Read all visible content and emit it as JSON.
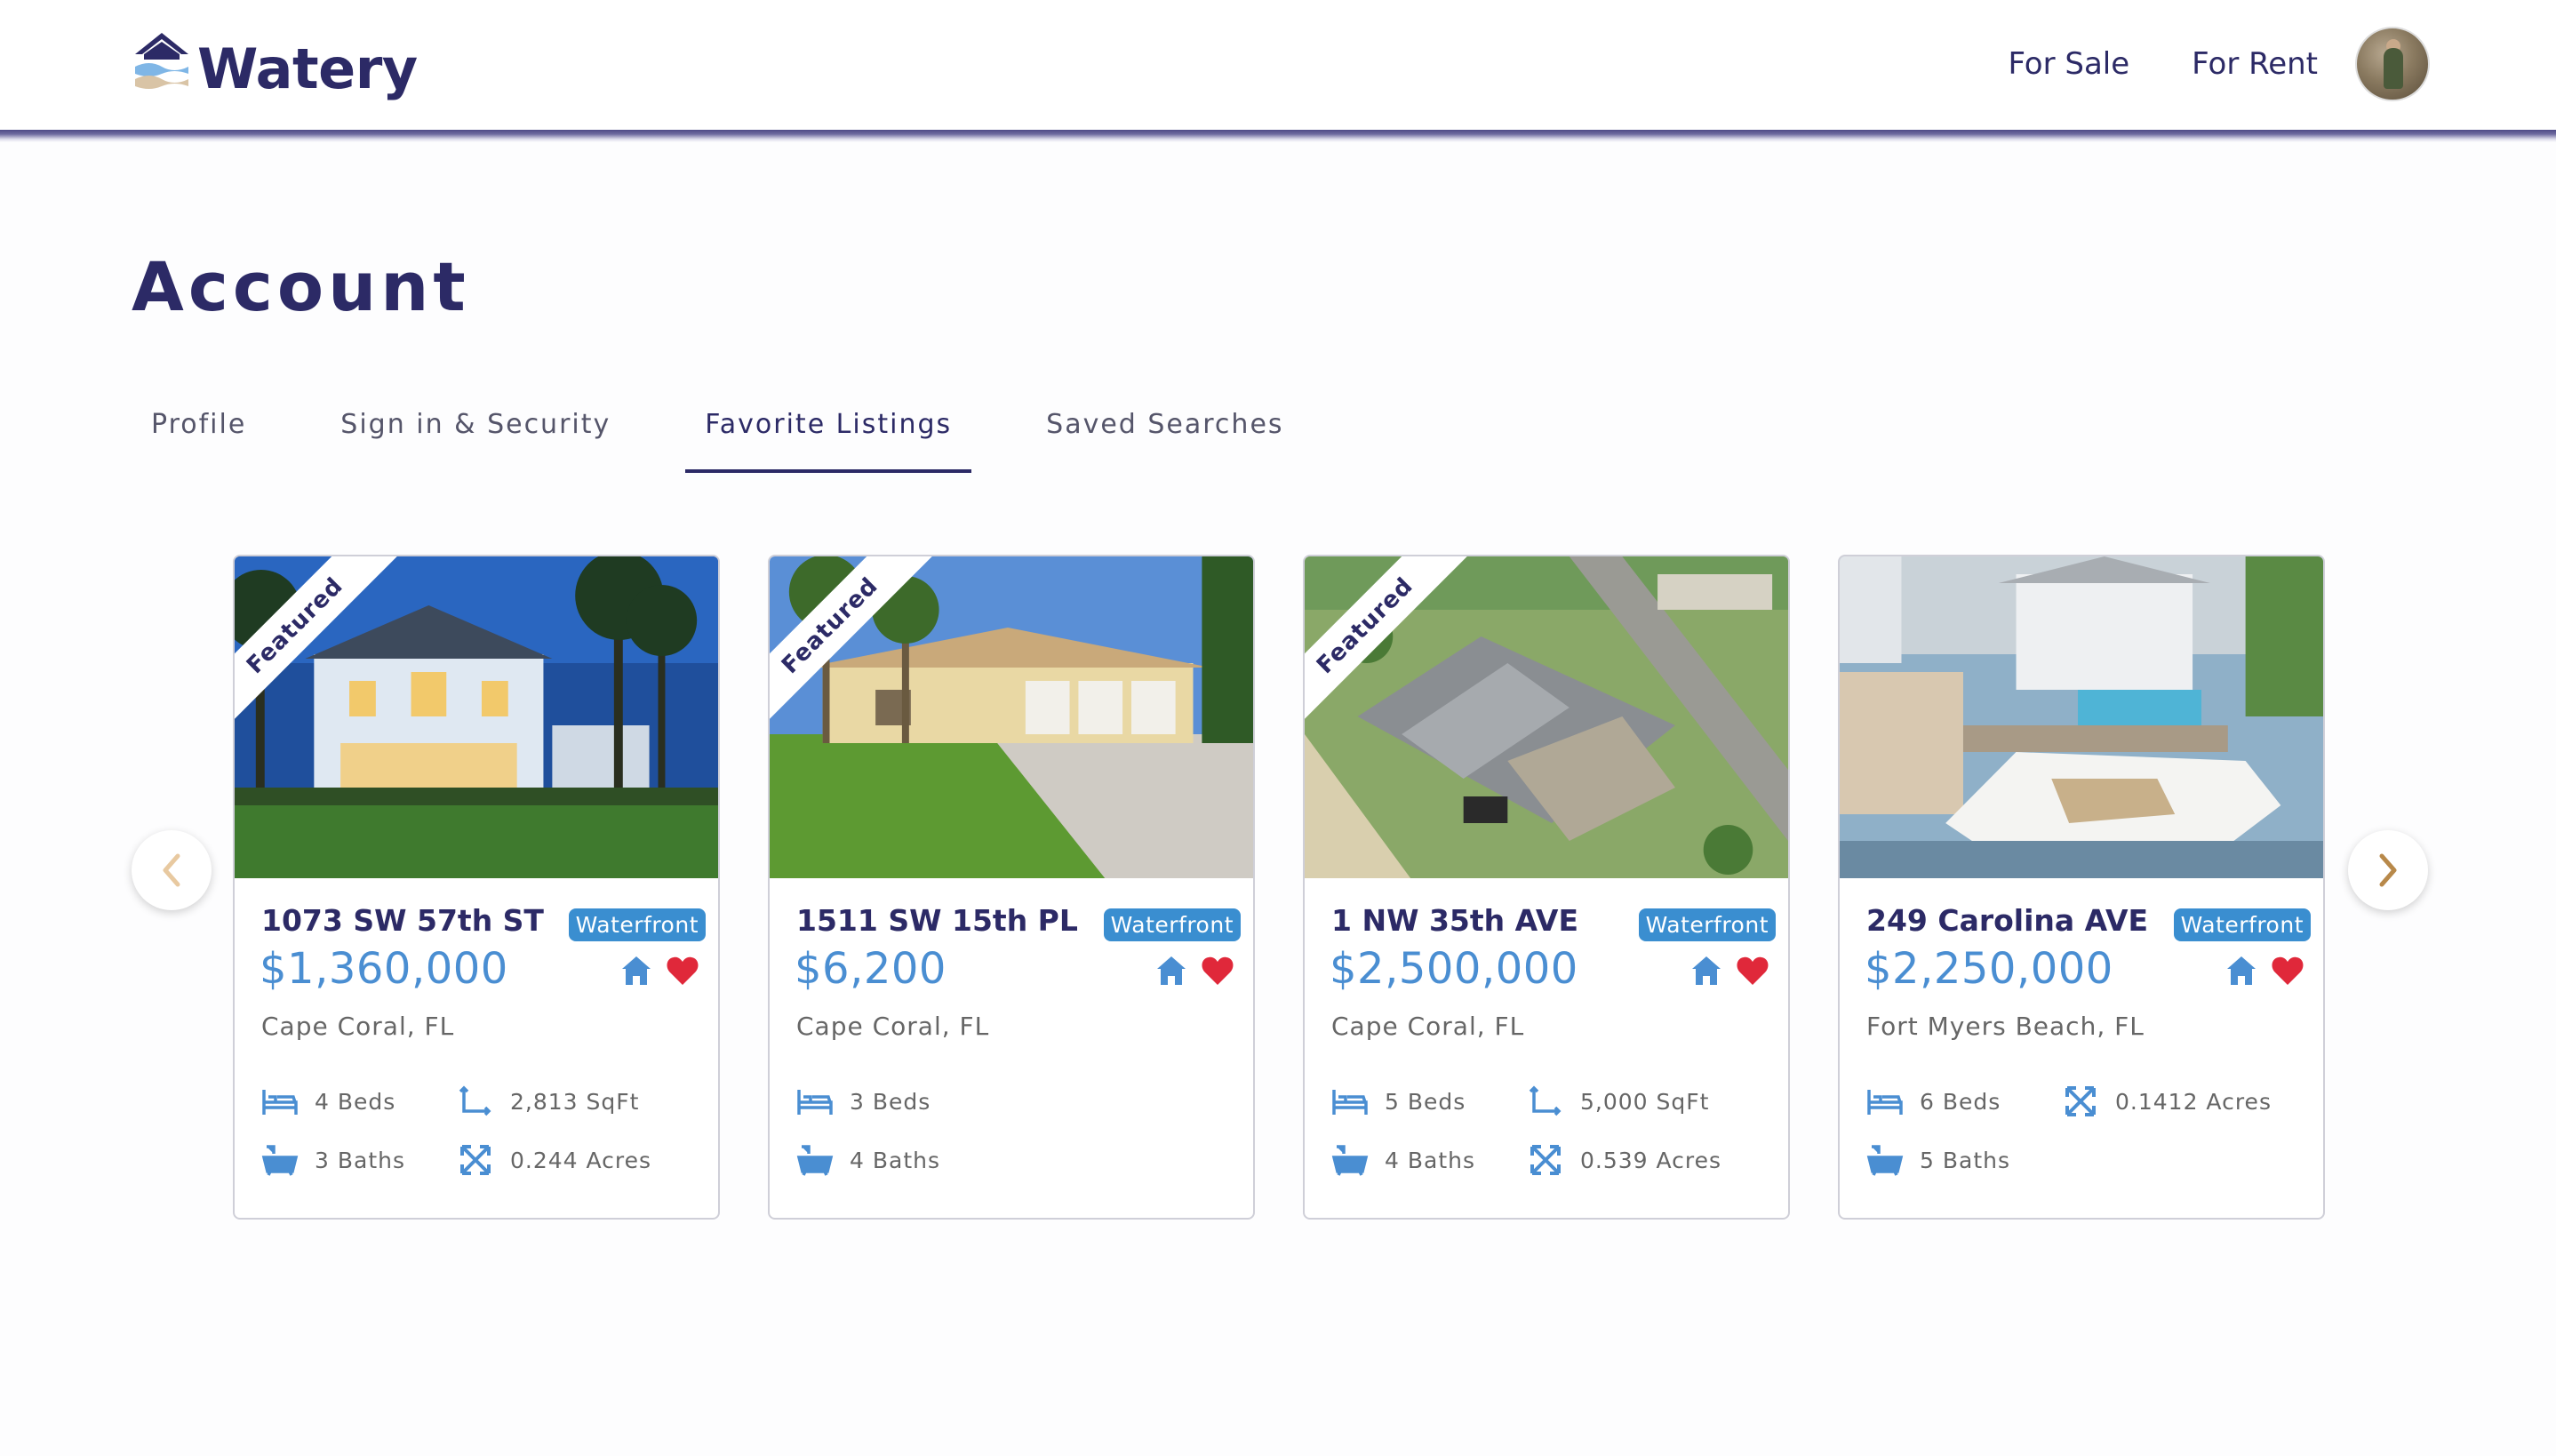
{
  "brand": {
    "name": "Watery",
    "logo_icon": "house-waves-logo"
  },
  "nav": {
    "for_sale": "For Sale",
    "for_rent": "For Rent",
    "avatar_icon": "user-avatar"
  },
  "page": {
    "title": "Account"
  },
  "tabs": [
    {
      "label": "Profile",
      "active": false
    },
    {
      "label": "Sign in & Security",
      "active": false
    },
    {
      "label": "Favorite Listings",
      "active": true
    },
    {
      "label": "Saved Searches",
      "active": false
    }
  ],
  "carousel": {
    "prev_icon": "chevron-left-icon",
    "next_icon": "chevron-right-icon"
  },
  "colors": {
    "brand": "#2c2a66",
    "accent_blue": "#4a8ed2",
    "badge_blue": "#3a8ed0",
    "heart_red": "#e0283a",
    "prev_arrow": "#e8c9a0",
    "next_arrow": "#b8894a"
  },
  "listings": [
    {
      "ribbon": "Featured",
      "address": "1073 SW 57th ST",
      "badge": "Waterfront",
      "price": "$1,360,000",
      "city": "Cape Coral, FL",
      "beds": "4 Beds",
      "baths": "3 Baths",
      "sqft": "2,813 SqFt",
      "acres": "0.244 Acres"
    },
    {
      "ribbon": "Featured",
      "address": "1511 SW 15th PL",
      "badge": "Waterfront",
      "price": "$6,200",
      "city": "Cape Coral, FL",
      "beds": "3 Beds",
      "baths": "4 Baths"
    },
    {
      "ribbon": "Featured",
      "address": "1 NW 35th AVE",
      "badge": "Waterfront",
      "price": "$2,500,000",
      "city": "Cape Coral, FL",
      "beds": "5 Beds",
      "baths": "4 Baths",
      "sqft": "5,000 SqFt",
      "acres": "0.539 Acres"
    },
    {
      "address": "249 Carolina AVE",
      "badge": "Waterfront",
      "price": "$2,250,000",
      "city": "Fort Myers Beach, FL",
      "beds": "6 Beds",
      "baths": "5 Baths",
      "acres": "0.1412 Acres"
    }
  ]
}
